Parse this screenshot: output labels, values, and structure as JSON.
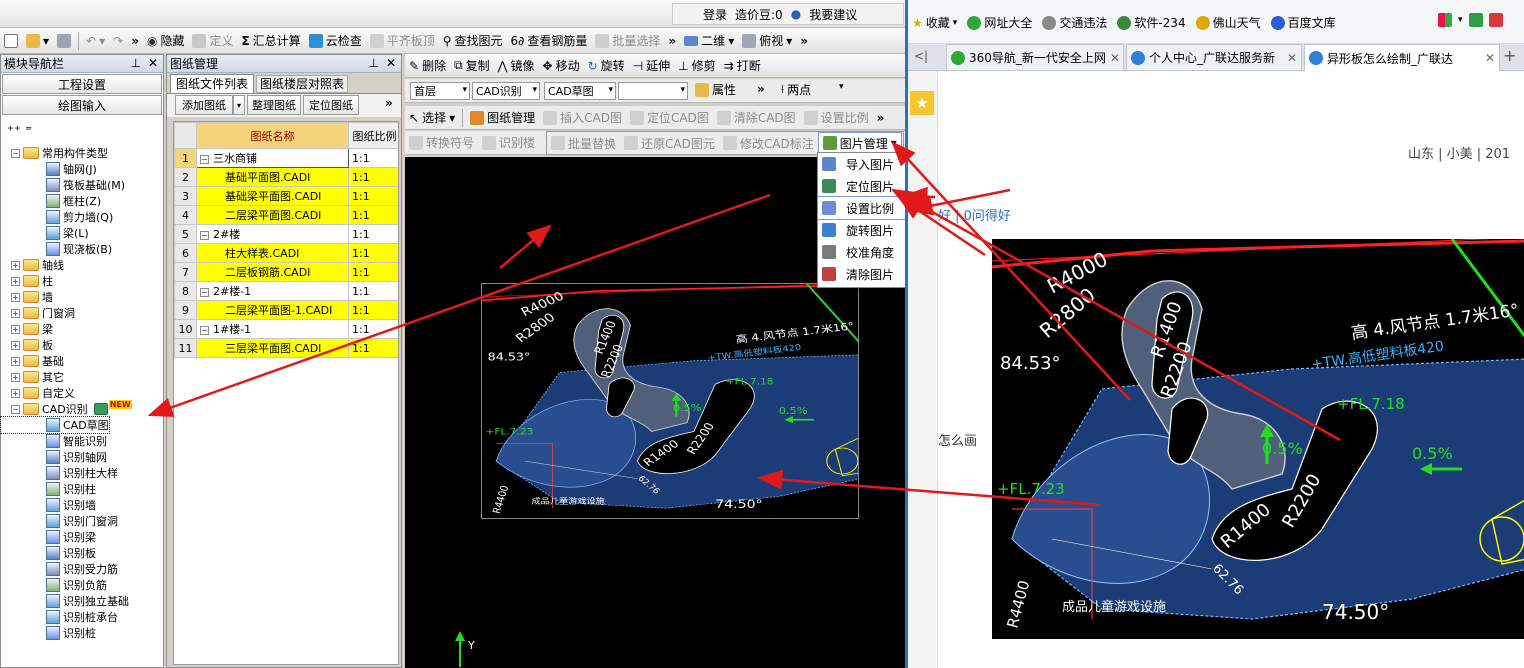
{
  "app": {
    "top_right": {
      "login": "登录",
      "cost_beans": "造价豆:0",
      "suggest": "我要建议"
    },
    "toolbar1": {
      "hide": "隐藏",
      "define": "定义",
      "summary_calc": "汇总计算",
      "cloud_check": "云检查",
      "align_slab_top": "平齐板顶",
      "find_element": "查找图元",
      "view_rebar": "查看钢筋量",
      "batch_select": "批量选择",
      "view_2d": "二维",
      "top_view": "俯视"
    },
    "nav": {
      "title": "模块导航栏",
      "project_settings": "工程设置",
      "drawing_input": "绘图输入",
      "tree": [
        {
          "label": "常用构件类型",
          "level": 0,
          "expander": "−"
        },
        {
          "label": "轴网(J)",
          "level": 1
        },
        {
          "label": "筏板基础(M)",
          "level": 1
        },
        {
          "label": "框柱(Z)",
          "level": 1
        },
        {
          "label": "剪力墙(Q)",
          "level": 1
        },
        {
          "label": "梁(L)",
          "level": 1
        },
        {
          "label": "现浇板(B)",
          "level": 1
        },
        {
          "label": "轴线",
          "level": 0,
          "expander": "+"
        },
        {
          "label": "柱",
          "level": 0,
          "expander": "+"
        },
        {
          "label": "墙",
          "level": 0,
          "expander": "+"
        },
        {
          "label": "门窗洞",
          "level": 0,
          "expander": "+"
        },
        {
          "label": "梁",
          "level": 0,
          "expander": "+"
        },
        {
          "label": "板",
          "level": 0,
          "expander": "+"
        },
        {
          "label": "基础",
          "level": 0,
          "expander": "+"
        },
        {
          "label": "其它",
          "level": 0,
          "expander": "+"
        },
        {
          "label": "自定义",
          "level": 0,
          "expander": "+"
        },
        {
          "label": "CAD识别",
          "level": 0,
          "expander": "−",
          "badge": "NEW"
        },
        {
          "label": "CAD草图",
          "level": 1
        },
        {
          "label": "智能识别",
          "level": 1
        },
        {
          "label": "识别轴网",
          "level": 1
        },
        {
          "label": "识别柱大样",
          "level": 1
        },
        {
          "label": "识别柱",
          "level": 1
        },
        {
          "label": "识别墙",
          "level": 1
        },
        {
          "label": "识别门窗洞",
          "level": 1
        },
        {
          "label": "识别梁",
          "level": 1
        },
        {
          "label": "识别板",
          "level": 1
        },
        {
          "label": "识别受力筋",
          "level": 1
        },
        {
          "label": "识别负筋",
          "level": 1
        },
        {
          "label": "识别独立基础",
          "level": 1
        },
        {
          "label": "识别桩承台",
          "level": 1
        },
        {
          "label": "识别桩",
          "level": 1
        }
      ]
    },
    "drawings": {
      "title": "图纸管理",
      "tabs": [
        "图纸文件列表",
        "图纸楼层对照表"
      ],
      "buttons": {
        "add": "添加图纸",
        "organize": "整理图纸",
        "locate": "定位图纸"
      },
      "columns": [
        "图纸名称",
        "图纸比例"
      ],
      "rows": [
        {
          "num": "1",
          "name": "三水商铺",
          "scale": "1:1",
          "group": true
        },
        {
          "num": "2",
          "name": "基础平面图.CADI",
          "scale": "1:1"
        },
        {
          "num": "3",
          "name": "基础梁平面图.CADI",
          "scale": "1:1"
        },
        {
          "num": "4",
          "name": "二层梁平面图.CADI",
          "scale": "1:1"
        },
        {
          "num": "5",
          "name": "2#楼",
          "scale": "1:1",
          "group": true
        },
        {
          "num": "6",
          "name": "柱大样表.CADI",
          "scale": "1:1"
        },
        {
          "num": "7",
          "name": "二层板钢筋.CADI",
          "scale": "1:1"
        },
        {
          "num": "8",
          "name": "2#楼-1",
          "scale": "1:1",
          "group": true
        },
        {
          "num": "9",
          "name": "二层梁平面图-1.CADI",
          "scale": "1:1"
        },
        {
          "num": "10",
          "name": "1#楼-1",
          "scale": "1:1",
          "group": true
        },
        {
          "num": "11",
          "name": "三层梁平面图.CADI",
          "scale": "1:1"
        }
      ]
    },
    "toolbar2": {
      "delete": "删除",
      "copy": "复制",
      "mirror": "镜像",
      "move": "移动",
      "rotate": "旋转",
      "extend": "延伸",
      "trim": "修剪",
      "break": "打断"
    },
    "toolbar3": {
      "floor": "首层",
      "cad_recog": "CAD识别",
      "cad_sketch": "CAD草图",
      "props": "属性",
      "two_points": "两点"
    },
    "toolbar4": {
      "select": "选择",
      "drawing_mgmt": "图纸管理",
      "insert_cad": "插入CAD图",
      "locate_cad": "定位CAD图",
      "clear_cad": "清除CAD图",
      "set_scale": "设置比例"
    },
    "toolbar5": {
      "convert_symbol": "转换符号",
      "recog_truncated": "识别楼",
      "batch_replace": "批量替换",
      "restore_cad": "还原CAD图元",
      "modify_cad_label": "修改CAD标注",
      "image_mgmt": "图片管理"
    },
    "context_menu": [
      "导入图片",
      "定位图片",
      "设置比例",
      "旋转图片",
      "校准角度",
      "清除图片"
    ],
    "canvas": {
      "axis_y": "Y"
    }
  },
  "cad_labels": [
    "R4000",
    "R2800",
    "R1400",
    "R2200",
    "R1400",
    "R2200",
    "R4400",
    "84.53°",
    "74.50°",
    "0.5%",
    "0.5%",
    "+FL.7.23",
    "+FL.7.18",
    "成品儿童游戏设施",
    "高 4.风节点 1.7米16°",
    "+TW.高低塑料板420",
    "62.76"
  ],
  "browser": {
    "favorites_label": "收藏",
    "favorites": [
      "网址大全",
      "交通违法",
      "软件-234",
      "佛山天气",
      "百度文库"
    ],
    "tabs": [
      "360导航_新一代安全上网",
      "个人中心_广联达服务新",
      "异形板怎么绘制_广联达"
    ],
    "content": {
      "meta": "山东 | 小美 | 201",
      "links": "好 | 0问得好",
      "snippet": "怎么画"
    }
  },
  "colors": {
    "accent": "#2c6fc7",
    "highlight": "#ffff00",
    "annotation_arrow": "#e01a1a",
    "cad_bg": "#000000",
    "slab_fill": "#1c3c78"
  }
}
